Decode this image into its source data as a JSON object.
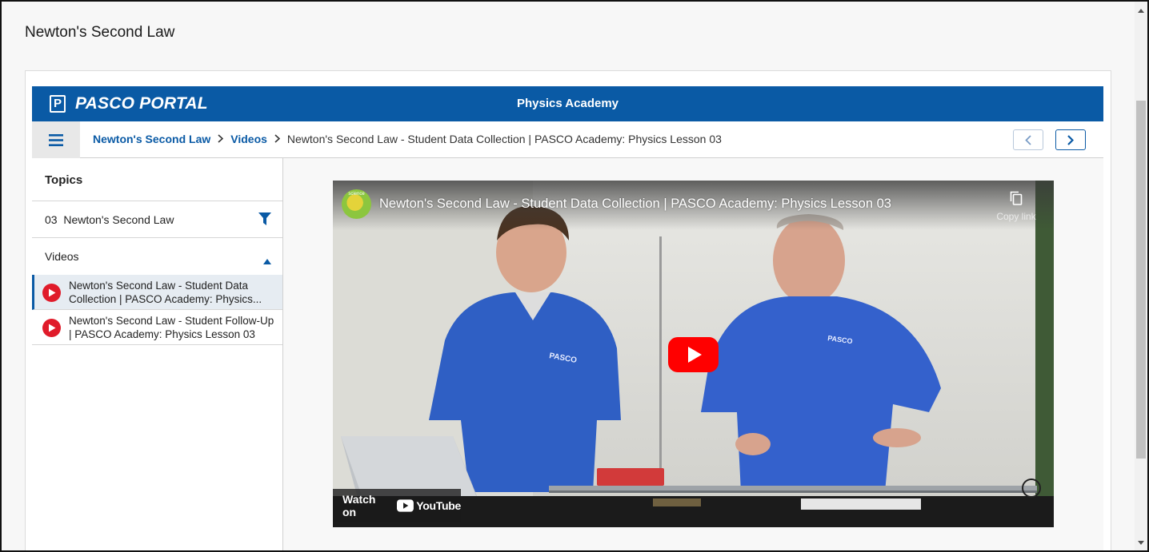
{
  "page": {
    "title": "Newton's Second Law"
  },
  "banner": {
    "logo_mark": "P",
    "logo_text": "PASCO PORTAL",
    "title": "Physics Academy",
    "color": "#0a5aa5"
  },
  "breadcrumb": {
    "menu_icon": "hamburger-menu-icon",
    "items": [
      {
        "label": "Newton's Second Law",
        "link": true
      },
      {
        "label": "Videos",
        "link": true
      },
      {
        "label": "Newton's Second Law - Student Data Collection | PASCO Academy: Physics Lesson 03",
        "link": false
      }
    ],
    "prev_icon": "chevron-left-icon",
    "next_icon": "chevron-right-icon"
  },
  "sidebar": {
    "heading": "Topics",
    "topic": {
      "label": "03  Newton's Second Law",
      "icon": "filter-icon"
    },
    "videos_section": {
      "label": "Videos",
      "icon": "caret-up-icon"
    },
    "videos": [
      {
        "title": "Newton's Second Law - Student Data Collection | PASCO Academy: Physics...",
        "active": true,
        "icon": "play-circle-icon"
      },
      {
        "title": "Newton's Second Law - Student Follow-Up | PASCO Academy: Physics Lesson 03",
        "active": false,
        "icon": "play-circle-icon"
      }
    ]
  },
  "player": {
    "channel_badge": "science",
    "title": "Newton's Second Law - Student Data Collection | PASCO Academy: Physics Lesson 03",
    "copy_link_label": "Copy link",
    "copy_icon": "copy-icon",
    "play_icon": "youtube-play-icon",
    "watch_on_label": "Watch on",
    "youtube_label": "YouTube",
    "shirt_text_left": "PASCO",
    "shirt_text_right": "PASCO",
    "accent_color": "#ff0000"
  }
}
